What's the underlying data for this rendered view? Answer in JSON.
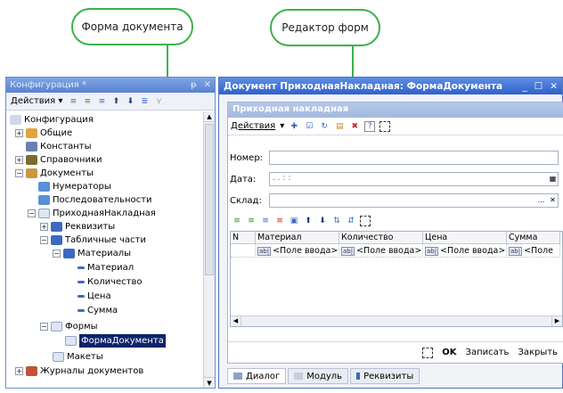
{
  "callouts": {
    "left": "Форма документа",
    "right": "Редактор форм"
  },
  "colors": {
    "accent": "#3db14a",
    "selection": "#0a246a",
    "title_bar": "#2f61cb"
  },
  "config_panel": {
    "title": "Конфигурация *",
    "pin": "ᵽ",
    "close": "✕",
    "actions_label": "Действия ▾",
    "tree": [
      {
        "label": "Конфигурация"
      },
      {
        "label": "Общие"
      },
      {
        "label": "Константы"
      },
      {
        "label": "Справочники"
      },
      {
        "label": "Документы"
      },
      {
        "label": "Нумераторы"
      },
      {
        "label": "Последовательности"
      },
      {
        "label": "ПриходнаяНакладная"
      },
      {
        "label": "Реквизиты"
      },
      {
        "label": "Табличные части"
      },
      {
        "label": "Материалы"
      },
      {
        "label": "Материал"
      },
      {
        "label": "Количество"
      },
      {
        "label": "Цена"
      },
      {
        "label": "Сумма"
      },
      {
        "label": "Формы"
      },
      {
        "label": "ФормаДокумента"
      },
      {
        "label": "Макеты"
      },
      {
        "label": "Журналы документов"
      }
    ]
  },
  "form_editor": {
    "window_title": "Документ ПриходнаяНакладная: ФормаДокумента",
    "ctrl_min": "_",
    "ctrl_max": "☐",
    "ctrl_close": "✕",
    "form_caption": "Приходная накладная",
    "actions_label": "Действия",
    "actions_arrow": "▾",
    "help": "?",
    "fields": {
      "number_label": "Номер:",
      "date_label": "Дата:",
      "date_value": ". .      : :",
      "warehouse_label": "Склад:",
      "warehouse_btn": "...",
      "warehouse_clear": "✕",
      "date_btn": "▦"
    },
    "table": {
      "columns": [
        "N",
        "Материал",
        "Количество",
        "Цена",
        "Сумма"
      ],
      "row": [
        "",
        "<Поле ввода>",
        "<Поле ввода>",
        "<Поле ввода>",
        "<Поле"
      ],
      "ab_label": "ab|"
    },
    "footer": {
      "ok": "OK",
      "write": "Записать",
      "close": "Закрыть"
    },
    "tabs": [
      "Диалог",
      "Модуль",
      "Реквизиты"
    ]
  }
}
